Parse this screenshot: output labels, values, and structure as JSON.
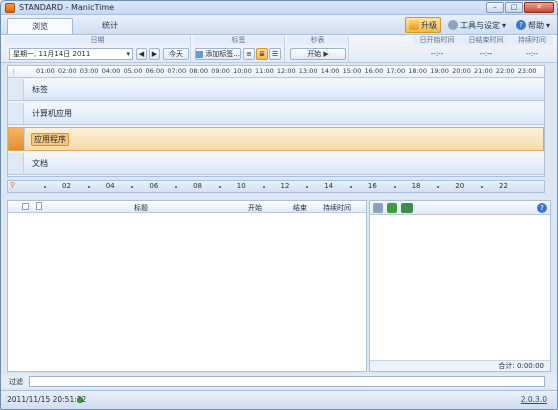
{
  "window": {
    "title": "STANDARD - ManicTime",
    "minimize": "–",
    "maximize": "□",
    "close": "✕"
  },
  "tabs": [
    {
      "label": "浏览"
    },
    {
      "label": "统计"
    }
  ],
  "top_actions": {
    "upgrade": "升级",
    "tools": "工具与设定",
    "help": "帮助"
  },
  "toolbar": {
    "date_group": "日期",
    "date_value": "星期一, 11月14日 2011",
    "prev": "◀",
    "next": "▶",
    "today": "今天",
    "tags_group": "标签",
    "add_tag": "添加标签...",
    "stopwatch_group": "秒表",
    "start": "开始",
    "day_start_label": "日开始时间",
    "day_end_label": "日结束时间",
    "duration_label": "持续时间",
    "day_start_value": "--:--",
    "day_end_value": "--:--",
    "duration_value": "--:--"
  },
  "ruler_hours": [
    "01:00",
    "02:00",
    "03:00",
    "04:00",
    "05:00",
    "06:00",
    "07:00",
    "08:00",
    "09:00",
    "10:00",
    "11:00",
    "12:00",
    "13:00",
    "14:00",
    "15:00",
    "16:00",
    "17:00",
    "18:00",
    "19:00",
    "20:00",
    "21:00",
    "22:00",
    "23:00"
  ],
  "timeline_rows": [
    {
      "label": "标签",
      "selected": false
    },
    {
      "label": "计算机应用",
      "selected": false
    },
    {
      "label": "应用程序",
      "selected": true
    },
    {
      "label": "文档",
      "selected": false
    }
  ],
  "nav_hours": [
    "02",
    "04",
    "06",
    "08",
    "10",
    "12",
    "14",
    "16",
    "18",
    "20",
    "22"
  ],
  "table": {
    "col_title": "标题",
    "col_start": "开始",
    "col_end": "结束",
    "col_duration": "持续时间"
  },
  "right_panel": {
    "total": "合计: 0:00:00"
  },
  "filter": {
    "label": "过滤",
    "value": ""
  },
  "status": {
    "datetime": "2011/11/15 20:51:32",
    "version": "2.0.3.0"
  },
  "colors": {
    "accent": "#f3b84b",
    "selected_row": "#f6dcaa",
    "chrome": "#dce7f4"
  }
}
